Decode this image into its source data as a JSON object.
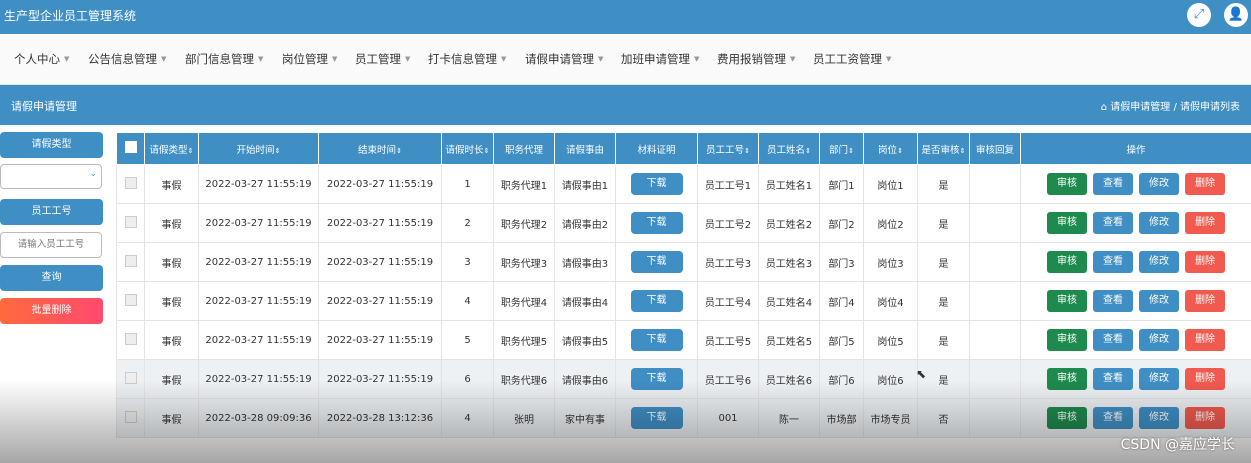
{
  "app": {
    "title": "生产型企业员工管理系统"
  },
  "topbar": {
    "fullscreen_icon": "⤢",
    "user_icon": "👤"
  },
  "nav": [
    {
      "label": "个人中心"
    },
    {
      "label": "公告信息管理"
    },
    {
      "label": "部门信息管理"
    },
    {
      "label": "岗位管理"
    },
    {
      "label": "员工管理"
    },
    {
      "label": "打卡信息管理"
    },
    {
      "label": "请假申请管理"
    },
    {
      "label": "加班申请管理"
    },
    {
      "label": "费用报销管理"
    },
    {
      "label": "员工工资管理"
    }
  ],
  "page": {
    "title": "请假申请管理",
    "breadcrumb": "请假申请管理 / 请假申请列表"
  },
  "sidebar": {
    "leave_type_label": "请假类型",
    "emp_no_label": "员工工号",
    "emp_no_placeholder": "请输入员工工号",
    "query_btn": "查询",
    "batch_delete_btn": "批量删除"
  },
  "table": {
    "headers": [
      "请假类型",
      "开始时间",
      "结束时间",
      "请假时长",
      "职务代理",
      "请假事由",
      "材料证明",
      "员工工号",
      "员工姓名",
      "部门",
      "岗位",
      "是否审核",
      "审核回复",
      "操作"
    ],
    "download_label": "下载",
    "ops": {
      "audit": "审核",
      "view": "查看",
      "edit": "修改",
      "delete": "删除"
    },
    "rows": [
      [
        "事假",
        "2022-03-27 11:55:19",
        "2022-03-27 11:55:19",
        "1",
        "职务代理1",
        "请假事由1",
        "员工工号1",
        "员工姓名1",
        "部门1",
        "岗位1",
        "是",
        ""
      ],
      [
        "事假",
        "2022-03-27 11:55:19",
        "2022-03-27 11:55:19",
        "2",
        "职务代理2",
        "请假事由2",
        "员工工号2",
        "员工姓名2",
        "部门2",
        "岗位2",
        "是",
        ""
      ],
      [
        "事假",
        "2022-03-27 11:55:19",
        "2022-03-27 11:55:19",
        "3",
        "职务代理3",
        "请假事由3",
        "员工工号3",
        "员工姓名3",
        "部门3",
        "岗位3",
        "是",
        ""
      ],
      [
        "事假",
        "2022-03-27 11:55:19",
        "2022-03-27 11:55:19",
        "4",
        "职务代理4",
        "请假事由4",
        "员工工号4",
        "员工姓名4",
        "部门4",
        "岗位4",
        "是",
        ""
      ],
      [
        "事假",
        "2022-03-27 11:55:19",
        "2022-03-27 11:55:19",
        "5",
        "职务代理5",
        "请假事由5",
        "员工工号5",
        "员工姓名5",
        "部门5",
        "岗位5",
        "是",
        ""
      ],
      [
        "事假",
        "2022-03-27 11:55:19",
        "2022-03-27 11:55:19",
        "6",
        "职务代理6",
        "请假事由6",
        "员工工号6",
        "员工姓名6",
        "部门6",
        "岗位6",
        "是",
        ""
      ],
      [
        "事假",
        "2022-03-28 09:09:36",
        "2022-03-28 13:12:36",
        "4",
        "张明",
        "家中有事",
        "001",
        "陈一",
        "市场部",
        "市场专员",
        "否",
        ""
      ]
    ]
  },
  "watermark": "CSDN @嘉应学长"
}
